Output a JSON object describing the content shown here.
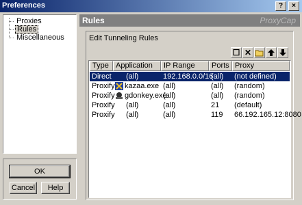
{
  "window": {
    "title": "Preferences",
    "help_button": "?",
    "close_button": "×"
  },
  "tree": {
    "items": [
      {
        "label": "Proxies",
        "selected": false
      },
      {
        "label": "Rules",
        "selected": true
      },
      {
        "label": "Miscellaneous",
        "selected": false
      }
    ]
  },
  "buttons": {
    "ok": "OK",
    "cancel": "Cancel",
    "help": "Help"
  },
  "panel": {
    "title": "Rules",
    "brand": "ProxyCap",
    "group_label": "Edit Tunneling Rules",
    "toolbar": [
      {
        "name": "new-rule-icon",
        "glyph": "☐"
      },
      {
        "name": "delete-icon",
        "glyph": "✕"
      },
      {
        "name": "open-folder-icon",
        "glyph": "📂"
      },
      {
        "name": "move-up-icon",
        "glyph": "🡅"
      },
      {
        "name": "move-down-icon",
        "glyph": "🡇"
      }
    ],
    "columns": [
      "Type",
      "Application",
      "IP Range",
      "Ports",
      "Proxy"
    ],
    "rows": [
      {
        "type": "Direct",
        "app": "(all)",
        "app_icon": "",
        "ip": "192.168.0.0/16",
        "ports": "(all)",
        "proxy": "(not defined)",
        "selected": true
      },
      {
        "type": "Proxify",
        "app": "kazaa.exe",
        "app_icon": "kazaa-icon",
        "ip": "(all)",
        "ports": "(all)",
        "proxy": "(random)",
        "selected": false
      },
      {
        "type": "Proxify",
        "app": "gdonkey.exe",
        "app_icon": "gdonkey-icon",
        "ip": "(all)",
        "ports": "(all)",
        "proxy": "(random)",
        "selected": false
      },
      {
        "type": "Proxify",
        "app": "(all)",
        "app_icon": "",
        "ip": "(all)",
        "ports": "21",
        "proxy": "(default)",
        "selected": false
      },
      {
        "type": "Proxify",
        "app": "(all)",
        "app_icon": "",
        "ip": "(all)",
        "ports": "119",
        "proxy": "66.192.165.12:8080",
        "selected": false
      }
    ]
  },
  "colors": {
    "selection": "#0a246a",
    "titlebar_start": "#0a246a",
    "titlebar_end": "#a6caf0",
    "face": "#d4d0c8"
  }
}
